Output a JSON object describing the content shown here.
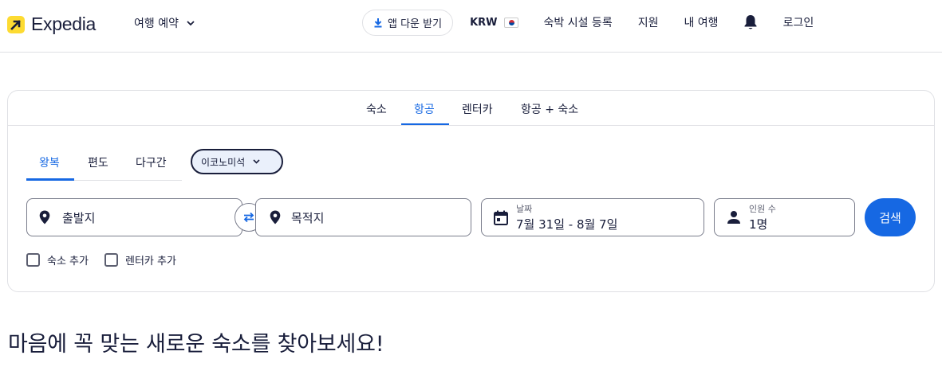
{
  "header": {
    "logo_text": "Expedia",
    "trip_menu_label": "여행 예약",
    "app_button_label": "앱 다운 받기",
    "currency": "KRW",
    "list_property": "숙박 시설 등록",
    "support": "지원",
    "my_trips": "내 여행",
    "login": "로그인"
  },
  "search": {
    "tabs": [
      "숙소",
      "항공",
      "렌터카",
      "항공 + 숙소"
    ],
    "active_tab": "항공",
    "trip_types": [
      "왕복",
      "편도",
      "다구간"
    ],
    "active_trip_type": "왕복",
    "cabin_class": "이코노미석",
    "origin_placeholder": "출발지",
    "destination_placeholder": "목적지",
    "dates_label": "날짜",
    "dates_value": "7월 31일 - 8월 7일",
    "travelers_label": "인원 수",
    "travelers_value": "1명",
    "search_button": "검색",
    "add_stay": "숙소 추가",
    "add_car": "렌터카 추가"
  },
  "hero": {
    "title": "마음에 꼭 맞는 새로운 숙소를 찾아보세요!"
  },
  "colors": {
    "brand_navy": "#191e3b",
    "accent_blue": "#1668e3",
    "logo_yellow": "#fddb32"
  }
}
